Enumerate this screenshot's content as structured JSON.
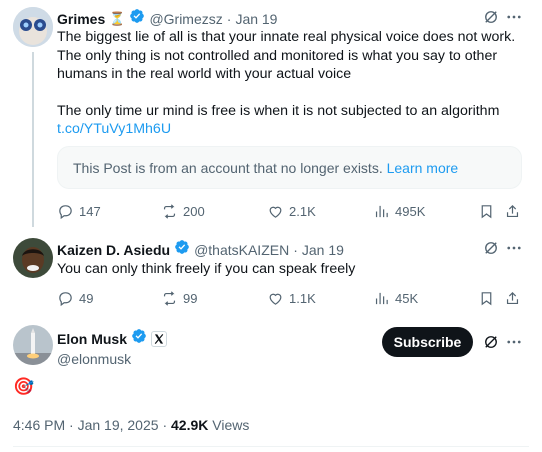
{
  "tweet1": {
    "display_name": "Grimes",
    "name_emoji": "⏳",
    "handle": "@Grimezsz",
    "separator": "·",
    "date": "Jan 19",
    "text_line1": "The biggest lie of all is that your innate real physical voice does not work.",
    "text_line2": "The only thing is not controlled and monitored is what you say to other",
    "text_line3": "humans in the real world with your actual voice",
    "text_line4": "The only time ur mind is free is when it is not subjected to an algorithm",
    "link": "t.co/YTuVy1Mh6U",
    "card_text": "This Post is from an account that no longer exists.",
    "card_link": "Learn more",
    "replies": "147",
    "reposts": "200",
    "likes": "2.1K",
    "views": "495K"
  },
  "tweet2": {
    "display_name": "Kaizen D. Asiedu",
    "handle": "@thatsKAIZEN",
    "separator": "·",
    "date": "Jan 19",
    "text": "You can only think freely if you can speak freely",
    "replies": "49",
    "reposts": "99",
    "likes": "1.1K",
    "views": "45K"
  },
  "main": {
    "display_name": "Elon Musk",
    "handle": "@elonmusk",
    "subscribe_label": "Subscribe",
    "emoji": "🎯",
    "timestamp": "4:46 PM · Jan 19, 2025",
    "separator": "·",
    "views_count": "42.9K",
    "views_label": "Views"
  },
  "colors": {
    "accent": "#1d9bf0",
    "text": "#0f1419",
    "muted": "#536471"
  }
}
